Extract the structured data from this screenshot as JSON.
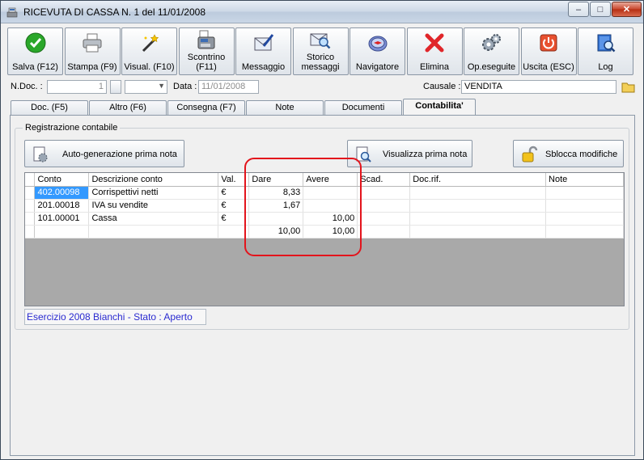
{
  "window": {
    "title": "RICEVUTA DI CASSA N. 1  del 11/01/2008",
    "min": "–",
    "max": "□",
    "close": "✕"
  },
  "toolbar": [
    {
      "name": "salva-button",
      "icon": "check-icon",
      "label": "Salva (F12)"
    },
    {
      "name": "stampa-button",
      "icon": "printer-icon",
      "label": "Stampa (F9)"
    },
    {
      "name": "visual-button",
      "icon": "magic-wand-icon",
      "label": "Visual. (F10)"
    },
    {
      "name": "scontrino-button",
      "icon": "cash-register-icon",
      "label": "Scontrino\n(F11)"
    },
    {
      "name": "messaggio-button",
      "icon": "envelope-pen-icon",
      "label": "Messaggio"
    },
    {
      "name": "storico-messaggi-button",
      "icon": "envelope-search-icon",
      "label": "Storico\nmessaggi"
    },
    {
      "name": "navigatore-button",
      "icon": "compass-icon",
      "label": "Navigatore"
    },
    {
      "name": "elimina-button",
      "icon": "red-x-icon",
      "label": "Elimina"
    },
    {
      "name": "op-eseguite-button",
      "icon": "gears-icon",
      "label": "Op.eseguite"
    },
    {
      "name": "uscita-button",
      "icon": "power-icon",
      "label": "Uscita (ESC)"
    },
    {
      "name": "log-button",
      "icon": "book-search-icon",
      "label": "Log"
    }
  ],
  "fields": {
    "ndoc_label": "N.Doc. :",
    "ndoc_value": "1",
    "data_label": "Data :",
    "data_value": "11/01/2008",
    "causale_label": "Causale :",
    "causale_value": "VENDITA"
  },
  "tabs": [
    {
      "label": "Doc. (F5)",
      "active": false
    },
    {
      "label": "Altro (F6)",
      "active": false
    },
    {
      "label": "Consegna (F7)",
      "active": false
    },
    {
      "label": "Note",
      "active": false
    },
    {
      "label": "Documenti",
      "active": false
    },
    {
      "label": "Contabilita'",
      "active": true
    }
  ],
  "registrazione": {
    "group_title": "Registrazione contabile",
    "autogen_label": "Auto-generazione prima nota",
    "visualizza_label": "Visualizza prima nota",
    "sblocca_label": "Sblocca modifiche"
  },
  "grid": {
    "columns": [
      "Conto",
      "Descrizione conto",
      "Val.",
      "Dare",
      "Avere",
      "Scad.",
      "Doc.rif.",
      "Note"
    ],
    "rows": [
      [
        "402.00098",
        "Corrispettivi netti",
        "€",
        "8,33",
        "",
        "",
        "",
        ""
      ],
      [
        "201.00018",
        "IVA su vendite",
        "€",
        "1,67",
        "",
        "",
        "",
        ""
      ],
      [
        "101.00001",
        "Cassa",
        "€",
        "",
        "10,00",
        "",
        "",
        ""
      ],
      [
        "",
        "",
        "",
        "10,00",
        "10,00",
        "",
        "",
        ""
      ]
    ]
  },
  "status": {
    "text": "Esercizio 2008 Bianchi - Stato : Aperto"
  },
  "colors": {
    "highlight": "#e3141c",
    "selection": "#3399ff",
    "status_text": "#2a2ad0"
  }
}
